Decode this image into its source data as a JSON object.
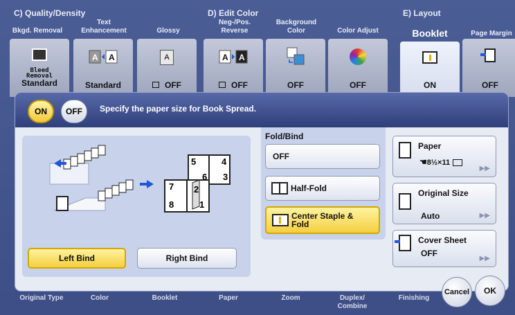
{
  "groups": {
    "quality": "C)  Quality/Density",
    "edit_color": "D)  Edit Color",
    "layout": "E)  Layout"
  },
  "columns": {
    "bkgd_removal": "Bkgd. Removal",
    "text_enh_1": "Text",
    "text_enh_2": "Enhancement",
    "glossy": "Glossy",
    "neg_1": "Neg-/Pos.",
    "neg_2": "Reverse",
    "bg_color_1": "Background",
    "bg_color_2": "Color",
    "color_adjust": "Color Adjust",
    "booklet": "Booklet",
    "page_margin": "Page Margin"
  },
  "tiles": {
    "bkgd_1": "Bleed",
    "bkgd_2": "Removal",
    "bkgd_3": "Standard",
    "text_enh": "Standard",
    "glossy": "OFF",
    "neg": "OFF",
    "bg_color": "OFF",
    "color_adjust": "OFF",
    "booklet": "ON",
    "page_margin": "OFF"
  },
  "dialog": {
    "on": "ON",
    "off": "OFF",
    "message": "Specify the paper size for Book Spread.",
    "left_bind": "Left Bind",
    "right_bind": "Right Bind",
    "fold_bind_title": "Fold/Bind",
    "fold_off": "OFF",
    "half_fold": "Half-Fold",
    "center_staple_1": "Center Staple &",
    "center_staple_2": "Fold",
    "paper_title": "Paper",
    "paper_value": "8½×11",
    "original_size_title": "Original Size",
    "original_size_value": "Auto",
    "cover_sheet_title": "Cover Sheet",
    "cover_sheet_value": "OFF",
    "pages_top": [
      "5",
      "4",
      "6",
      "3"
    ],
    "pages_bottom": [
      "7",
      "2",
      "8",
      "1"
    ]
  },
  "bottom_tabs": {
    "original_type": "Original Type",
    "color": "Color",
    "booklet": "Booklet",
    "paper": "Paper",
    "zoom": "Zoom",
    "duplex_1": "Duplex/",
    "duplex_2": "Combine",
    "finishing": "Finishing"
  },
  "actions": {
    "cancel": "Cancel",
    "ok": "OK"
  },
  "colors": {
    "selected": "#f4cf40",
    "accent_arrow": "#1f57d6",
    "header": "#3d4f86"
  }
}
